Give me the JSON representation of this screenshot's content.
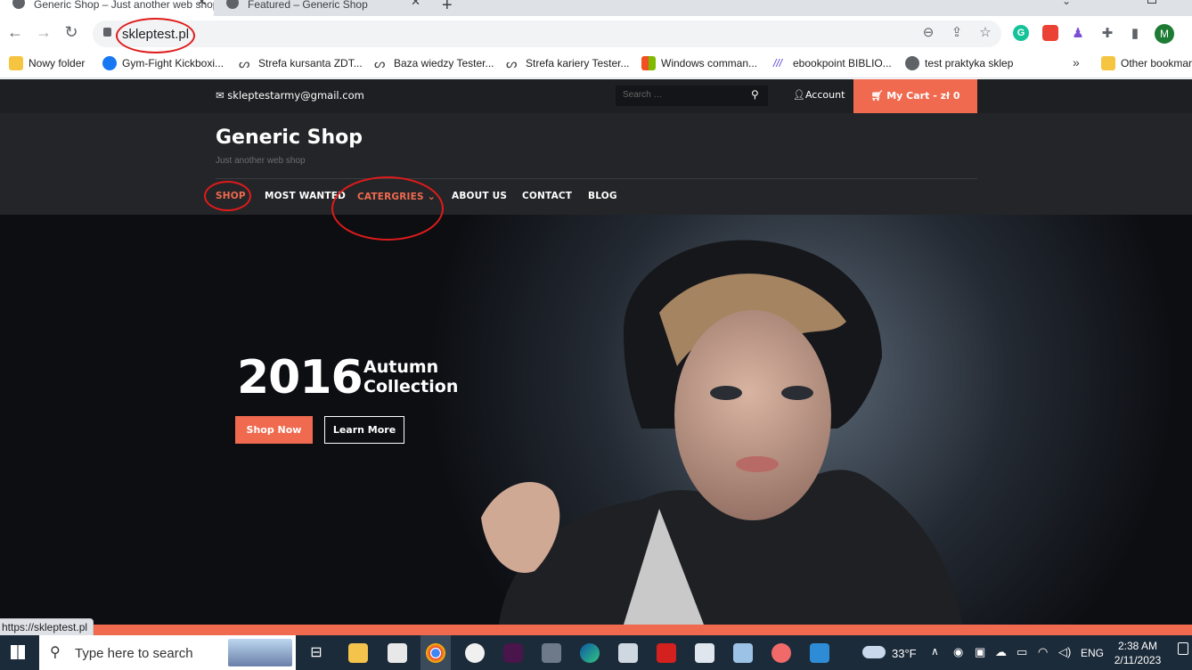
{
  "browser": {
    "tabs": [
      {
        "title": "Generic Shop – Just another web shop",
        "active": true
      },
      {
        "title": "Featured – Generic Shop",
        "active": false
      }
    ],
    "new_tab_glyph": "+",
    "close_glyph": "✕",
    "url": "skleptest.pl",
    "bookmarks": [
      {
        "label": "Nowy folder",
        "icon": "folder-icon",
        "color": "#f5c542"
      },
      {
        "label": "Gym-Fight Kickboxi...",
        "icon": "facebook-icon",
        "color": "#1877f2"
      },
      {
        "label": "Strefa kursanta ZDT...",
        "icon": "tester-logo-icon",
        "color": "#444444"
      },
      {
        "label": "Baza wiedzy Tester...",
        "icon": "tester-logo-icon",
        "color": "#444444"
      },
      {
        "label": "Strefa kariery Tester...",
        "icon": "tester-logo-icon",
        "color": "#444444"
      },
      {
        "label": "Windows comman...",
        "icon": "windows-logo-icon",
        "color": "#00a4ef"
      },
      {
        "label": "ebookpoint BIBLIO...",
        "icon": "ebookpoint-icon",
        "color": "#5b3fd1"
      },
      {
        "label": "test praktyka sklep",
        "icon": "globe-icon",
        "color": "#5f6368"
      }
    ],
    "overflow_glyph": "»",
    "other_bookmarks": "Other bookmarks",
    "profile_initial": "M",
    "status_url": "https://skleptest.pl"
  },
  "site": {
    "email": "skleptestarmy@gmail.com",
    "search_placeholder": "Search …",
    "account_label": "Account",
    "cart_label": "My Cart - zł 0",
    "title": "Generic Shop",
    "tagline": "Just another web shop",
    "nav": [
      {
        "label": "SHOP",
        "active": true
      },
      {
        "label": "MOST WANTED",
        "active": false
      },
      {
        "label": "CATERGRIES",
        "active": true,
        "dropdown": true
      },
      {
        "label": "ABOUT US",
        "active": false
      },
      {
        "label": "CONTACT",
        "active": false
      },
      {
        "label": "BLOG",
        "active": false
      }
    ],
    "dropdown_glyph": "⌄",
    "hero": {
      "year": "2016",
      "line1": "Autumn",
      "line2": "Collection",
      "primary_button": "Shop Now",
      "secondary_button": "Learn More"
    },
    "colors": {
      "accent": "#f06a4f",
      "dark": "#242528"
    }
  },
  "taskbar": {
    "search_placeholder": "Type here to search",
    "weather": "33°F",
    "language": "ENG",
    "time": "2:38 AM",
    "date": "2/11/2023",
    "apps": [
      "task-view-icon",
      "file-explorer-icon",
      "store-icon",
      "chrome-icon",
      "paint-icon",
      "slack-icon",
      "calculator-icon",
      "edge-icon",
      "notepad-icon",
      "acrobat-icon",
      "editor-icon",
      "notes-icon",
      "asana-icon",
      "photos-icon"
    ]
  }
}
